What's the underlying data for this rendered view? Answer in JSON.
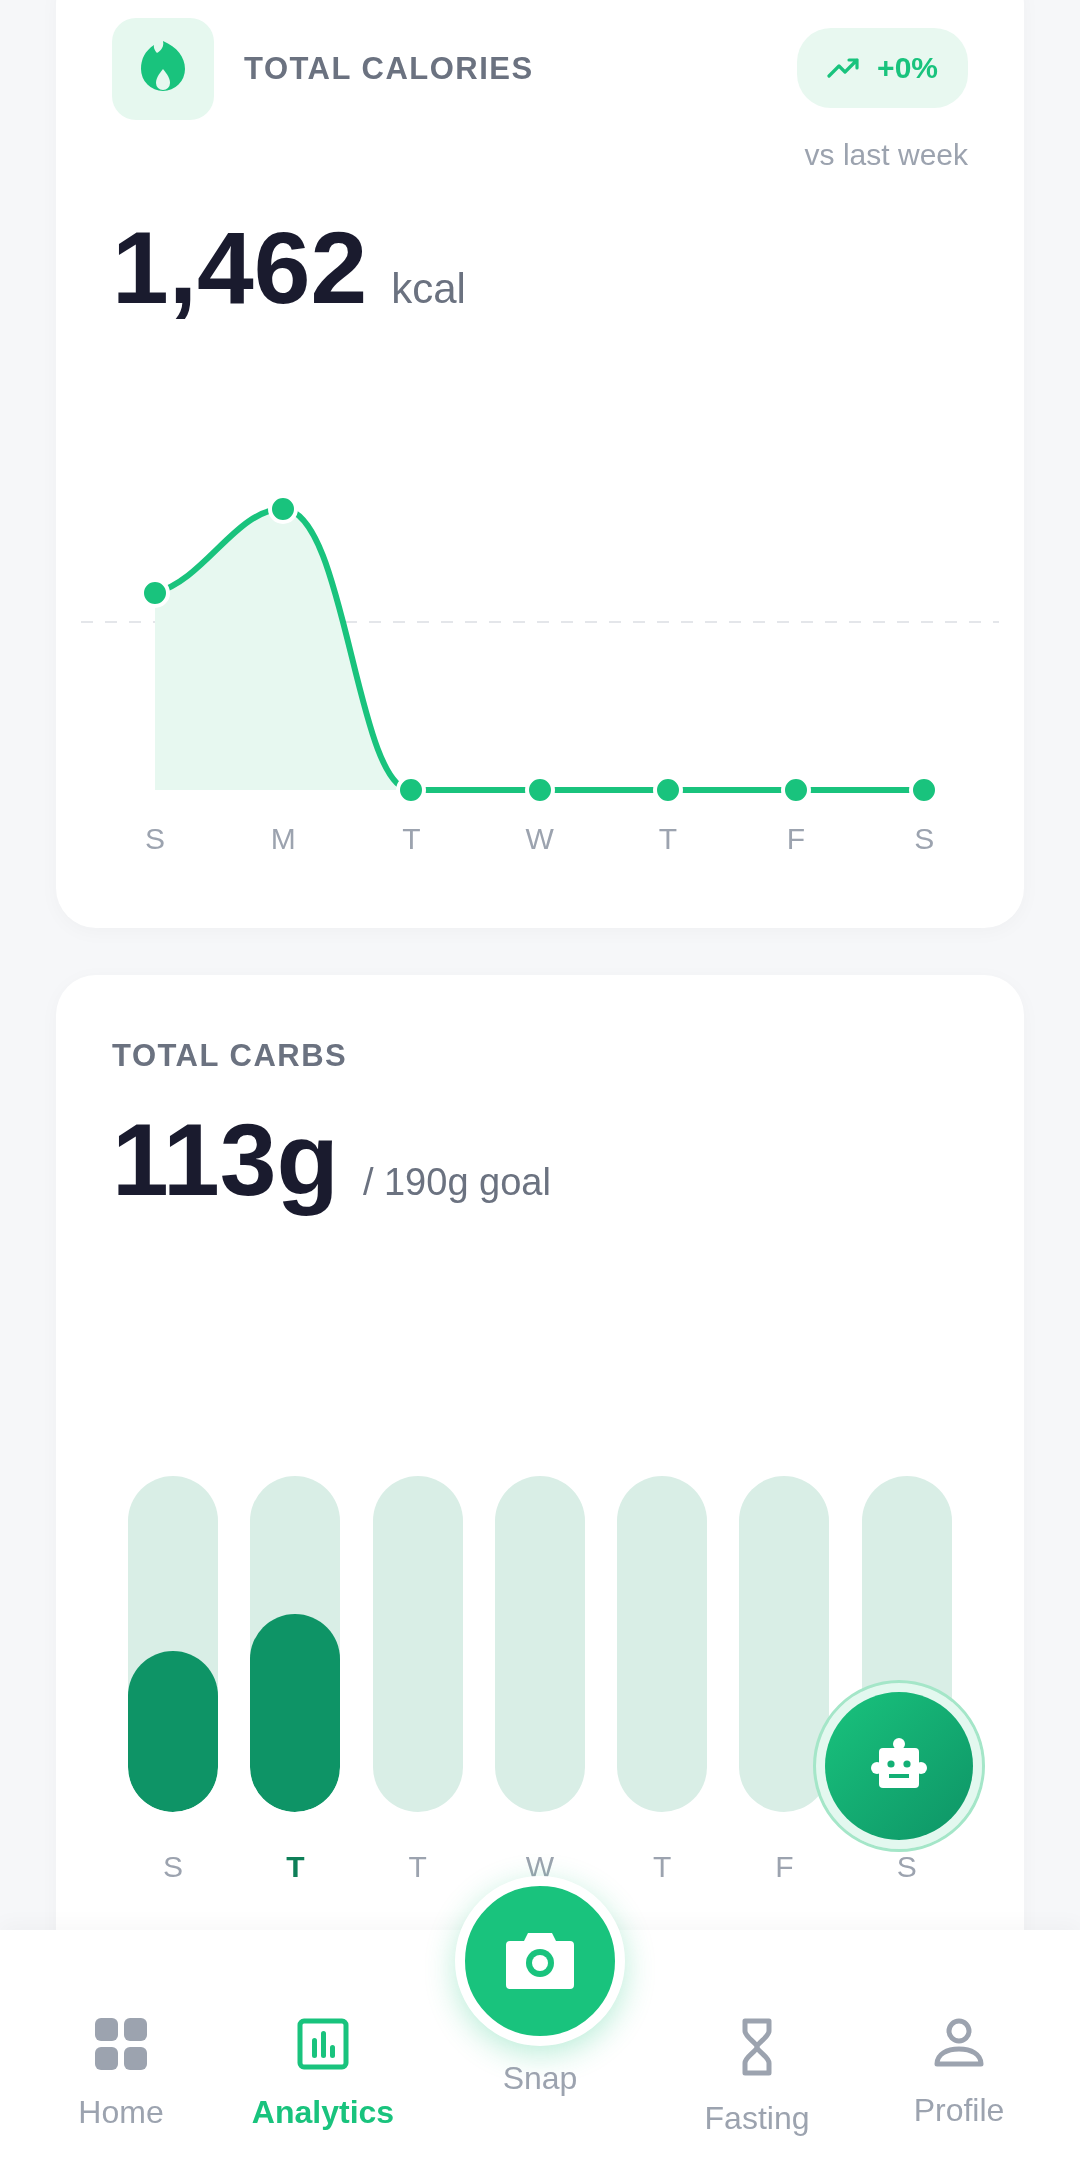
{
  "calories_card": {
    "title": "TOTAL CALORIES",
    "trend": {
      "value": "+0%",
      "caption": "vs last week"
    },
    "value": "1,462",
    "unit": "kcal",
    "chart": {
      "days": [
        "S",
        "M",
        "T",
        "W",
        "T",
        "F",
        "S"
      ]
    }
  },
  "carbs_card": {
    "title": "TOTAL CARBS",
    "value": "113g",
    "goal": "/ 190g goal",
    "bars": [
      {
        "day": "S",
        "level": 0.48,
        "selected": false
      },
      {
        "day": "T",
        "level": 0.59,
        "selected": true
      },
      {
        "day": "T",
        "selected": false
      },
      {
        "day": "W",
        "selected": false
      },
      {
        "day": "T",
        "selected": false
      },
      {
        "day": "F",
        "selected": false
      },
      {
        "day": "S",
        "selected": false
      }
    ]
  },
  "bottom_nav": [
    {
      "label": "Home",
      "kind": "tab",
      "selected": false
    },
    {
      "label": "Analytics",
      "kind": "tab",
      "selected": true
    },
    {
      "label": "Snap",
      "kind": "action",
      "selected": false
    },
    {
      "label": "Fasting",
      "kind": "tab",
      "selected": false
    },
    {
      "label": "Profile",
      "kind": "tab",
      "selected": false
    }
  ]
}
